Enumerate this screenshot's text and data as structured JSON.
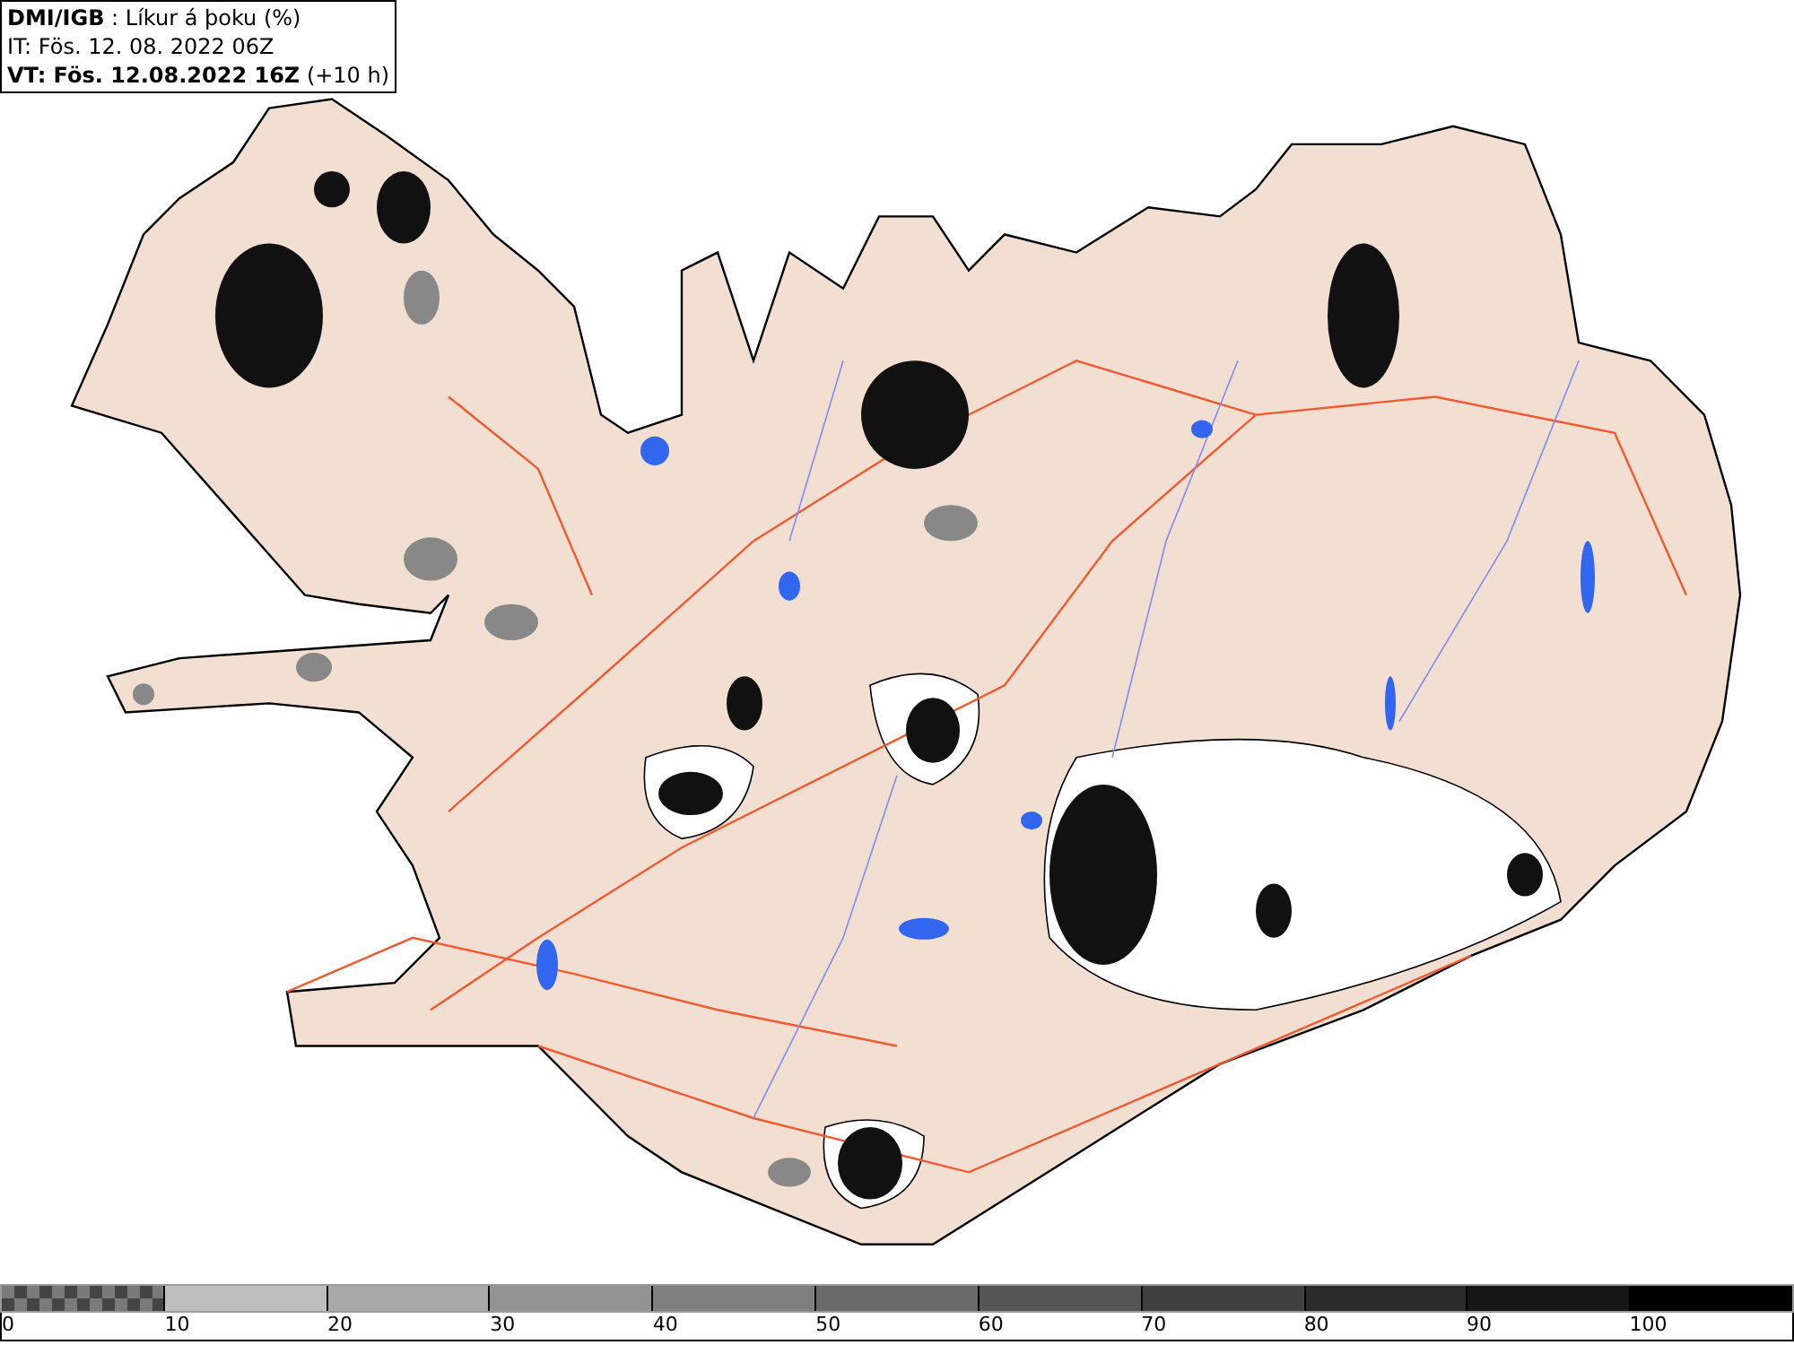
{
  "info_box": {
    "lines": [
      "**DMI/IGB** : Líkur á þoku (%)",
      "IT: Fös. 12. 08. 2022 06Z",
      "**VT: Fös. 12.08.2022 16Z** (+10 h)"
    ]
  },
  "legend": {
    "swatches": [
      {
        "kind": "checkered",
        "color": "#7a7a7a"
      },
      {
        "kind": "solid",
        "color": "#bdbdbd"
      },
      {
        "kind": "solid",
        "color": "#a8a8a8"
      },
      {
        "kind": "solid",
        "color": "#939393"
      },
      {
        "kind": "solid",
        "color": "#7e7e7e"
      },
      {
        "kind": "solid",
        "color": "#6a6a6a"
      },
      {
        "kind": "solid",
        "color": "#555555"
      },
      {
        "kind": "solid",
        "color": "#404040"
      },
      {
        "kind": "solid",
        "color": "#2b2b2b"
      },
      {
        "kind": "solid",
        "color": "#161616"
      },
      {
        "kind": "solid",
        "color": "#000000"
      }
    ],
    "ticks": [
      "0",
      "10",
      "20",
      "30",
      "40",
      "50",
      "60",
      "70",
      "80",
      "90",
      "100"
    ]
  }
}
